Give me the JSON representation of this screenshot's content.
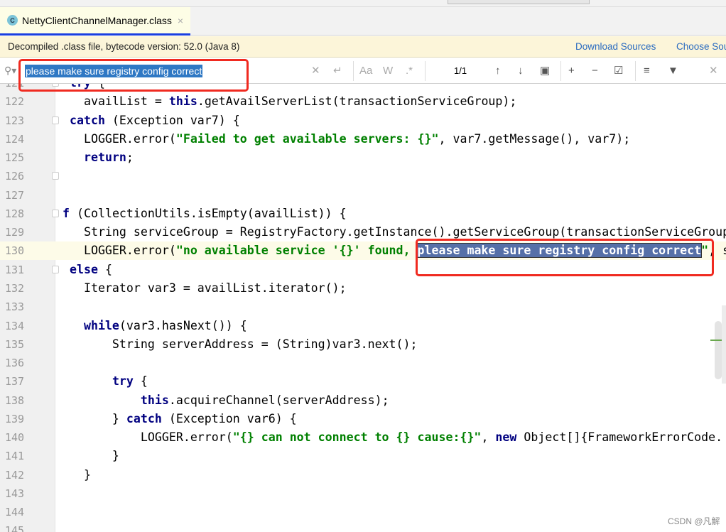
{
  "tab": {
    "file_name": "NettyClientChannelManager.class",
    "file_icon": "c-class-icon",
    "close_icon": "×"
  },
  "banner": {
    "message": "Decompiled .class file, bytecode version: 52.0 (Java 8)",
    "download_sources": "Download Sources",
    "choose_sources": "Choose Sou"
  },
  "search": {
    "query": "please make sure registry config correct",
    "match_count": "1/1",
    "match_case": "Aa",
    "words": "W",
    "regex": ".*"
  },
  "editor": {
    "current_line": "130",
    "lines": [
      {
        "n": "121",
        "fold": true,
        "seg": [
          [
            "  ",
            "p"
          ],
          [
            "try",
            "k"
          ],
          [
            " {",
            "p"
          ]
        ]
      },
      {
        "n": "122",
        "seg": [
          [
            "    availList = ",
            "p"
          ],
          [
            "this",
            "k"
          ],
          [
            ".getAvailServerList(transactionServiceGroup);",
            "p"
          ]
        ]
      },
      {
        "n": "123",
        "fold": true,
        "seg": [
          [
            "  ",
            "p"
          ],
          [
            "catch",
            "k"
          ],
          [
            " (Exception var7) {",
            "p"
          ]
        ]
      },
      {
        "n": "124",
        "seg": [
          [
            "    LOGGER.error(",
            "p"
          ],
          [
            "\"Failed to get available servers: {}\"",
            "s"
          ],
          [
            ", var7.getMessage(), var7);",
            "p"
          ]
        ]
      },
      {
        "n": "125",
        "seg": [
          [
            "    ",
            "p"
          ],
          [
            "return",
            "k"
          ],
          [
            ";",
            "p"
          ]
        ]
      },
      {
        "n": "126",
        "fold": true,
        "seg": []
      },
      {
        "n": "127",
        "seg": []
      },
      {
        "n": "128",
        "fold": true,
        "seg": [
          [
            " ",
            "p"
          ],
          [
            "f",
            "k"
          ],
          [
            " (CollectionUtils.isEmpty(availList)) {",
            "p"
          ]
        ]
      },
      {
        "n": "129",
        "seg": [
          [
            "    String serviceGroup = RegistryFactory.getInstance().getServiceGroup(transactionServiceGroup);",
            "p"
          ]
        ]
      },
      {
        "n": "130",
        "seg": [
          [
            "    LOGGER.error(",
            "p"
          ],
          [
            "\"no available service '{}' found, ",
            "s"
          ],
          [
            "please make sure registry config correct",
            "h"
          ],
          [
            "\"",
            "s"
          ],
          [
            ", serviceGroup);",
            "p"
          ]
        ]
      },
      {
        "n": "131",
        "fold": true,
        "seg": [
          [
            "  ",
            "p"
          ],
          [
            "else",
            "k"
          ],
          [
            " {",
            "p"
          ]
        ]
      },
      {
        "n": "132",
        "seg": [
          [
            "    Iterator var3 = availList.iterator();",
            "p"
          ]
        ]
      },
      {
        "n": "133",
        "seg": []
      },
      {
        "n": "134",
        "seg": [
          [
            "    ",
            "p"
          ],
          [
            "while",
            "k"
          ],
          [
            "(var3.hasNext()) {",
            "p"
          ]
        ]
      },
      {
        "n": "135",
        "seg": [
          [
            "        String serverAddress = (String)var3.next();",
            "p"
          ]
        ]
      },
      {
        "n": "136",
        "seg": []
      },
      {
        "n": "137",
        "seg": [
          [
            "        ",
            "p"
          ],
          [
            "try",
            "k"
          ],
          [
            " {",
            "p"
          ]
        ]
      },
      {
        "n": "138",
        "seg": [
          [
            "            ",
            "p"
          ],
          [
            "this",
            "k"
          ],
          [
            ".acquireChannel(serverAddress);",
            "p"
          ]
        ]
      },
      {
        "n": "139",
        "seg": [
          [
            "        } ",
            "p"
          ],
          [
            "catch",
            "k"
          ],
          [
            " (Exception var6) {",
            "p"
          ]
        ]
      },
      {
        "n": "140",
        "seg": [
          [
            "            LOGGER.error(",
            "p"
          ],
          [
            "\"{} can not connect to {} cause:{}\"",
            "s"
          ],
          [
            ", ",
            "p"
          ],
          [
            "new",
            "k"
          ],
          [
            " Object[]{FrameworkErrorCode.",
            "p"
          ]
        ]
      },
      {
        "n": "141",
        "seg": [
          [
            "        }",
            "p"
          ]
        ]
      },
      {
        "n": "142",
        "seg": [
          [
            "    }",
            "p"
          ]
        ]
      },
      {
        "n": "143",
        "seg": []
      },
      {
        "n": "144",
        "seg": []
      },
      {
        "n": "145",
        "seg": []
      }
    ]
  },
  "watermark": "CSDN @凡解"
}
